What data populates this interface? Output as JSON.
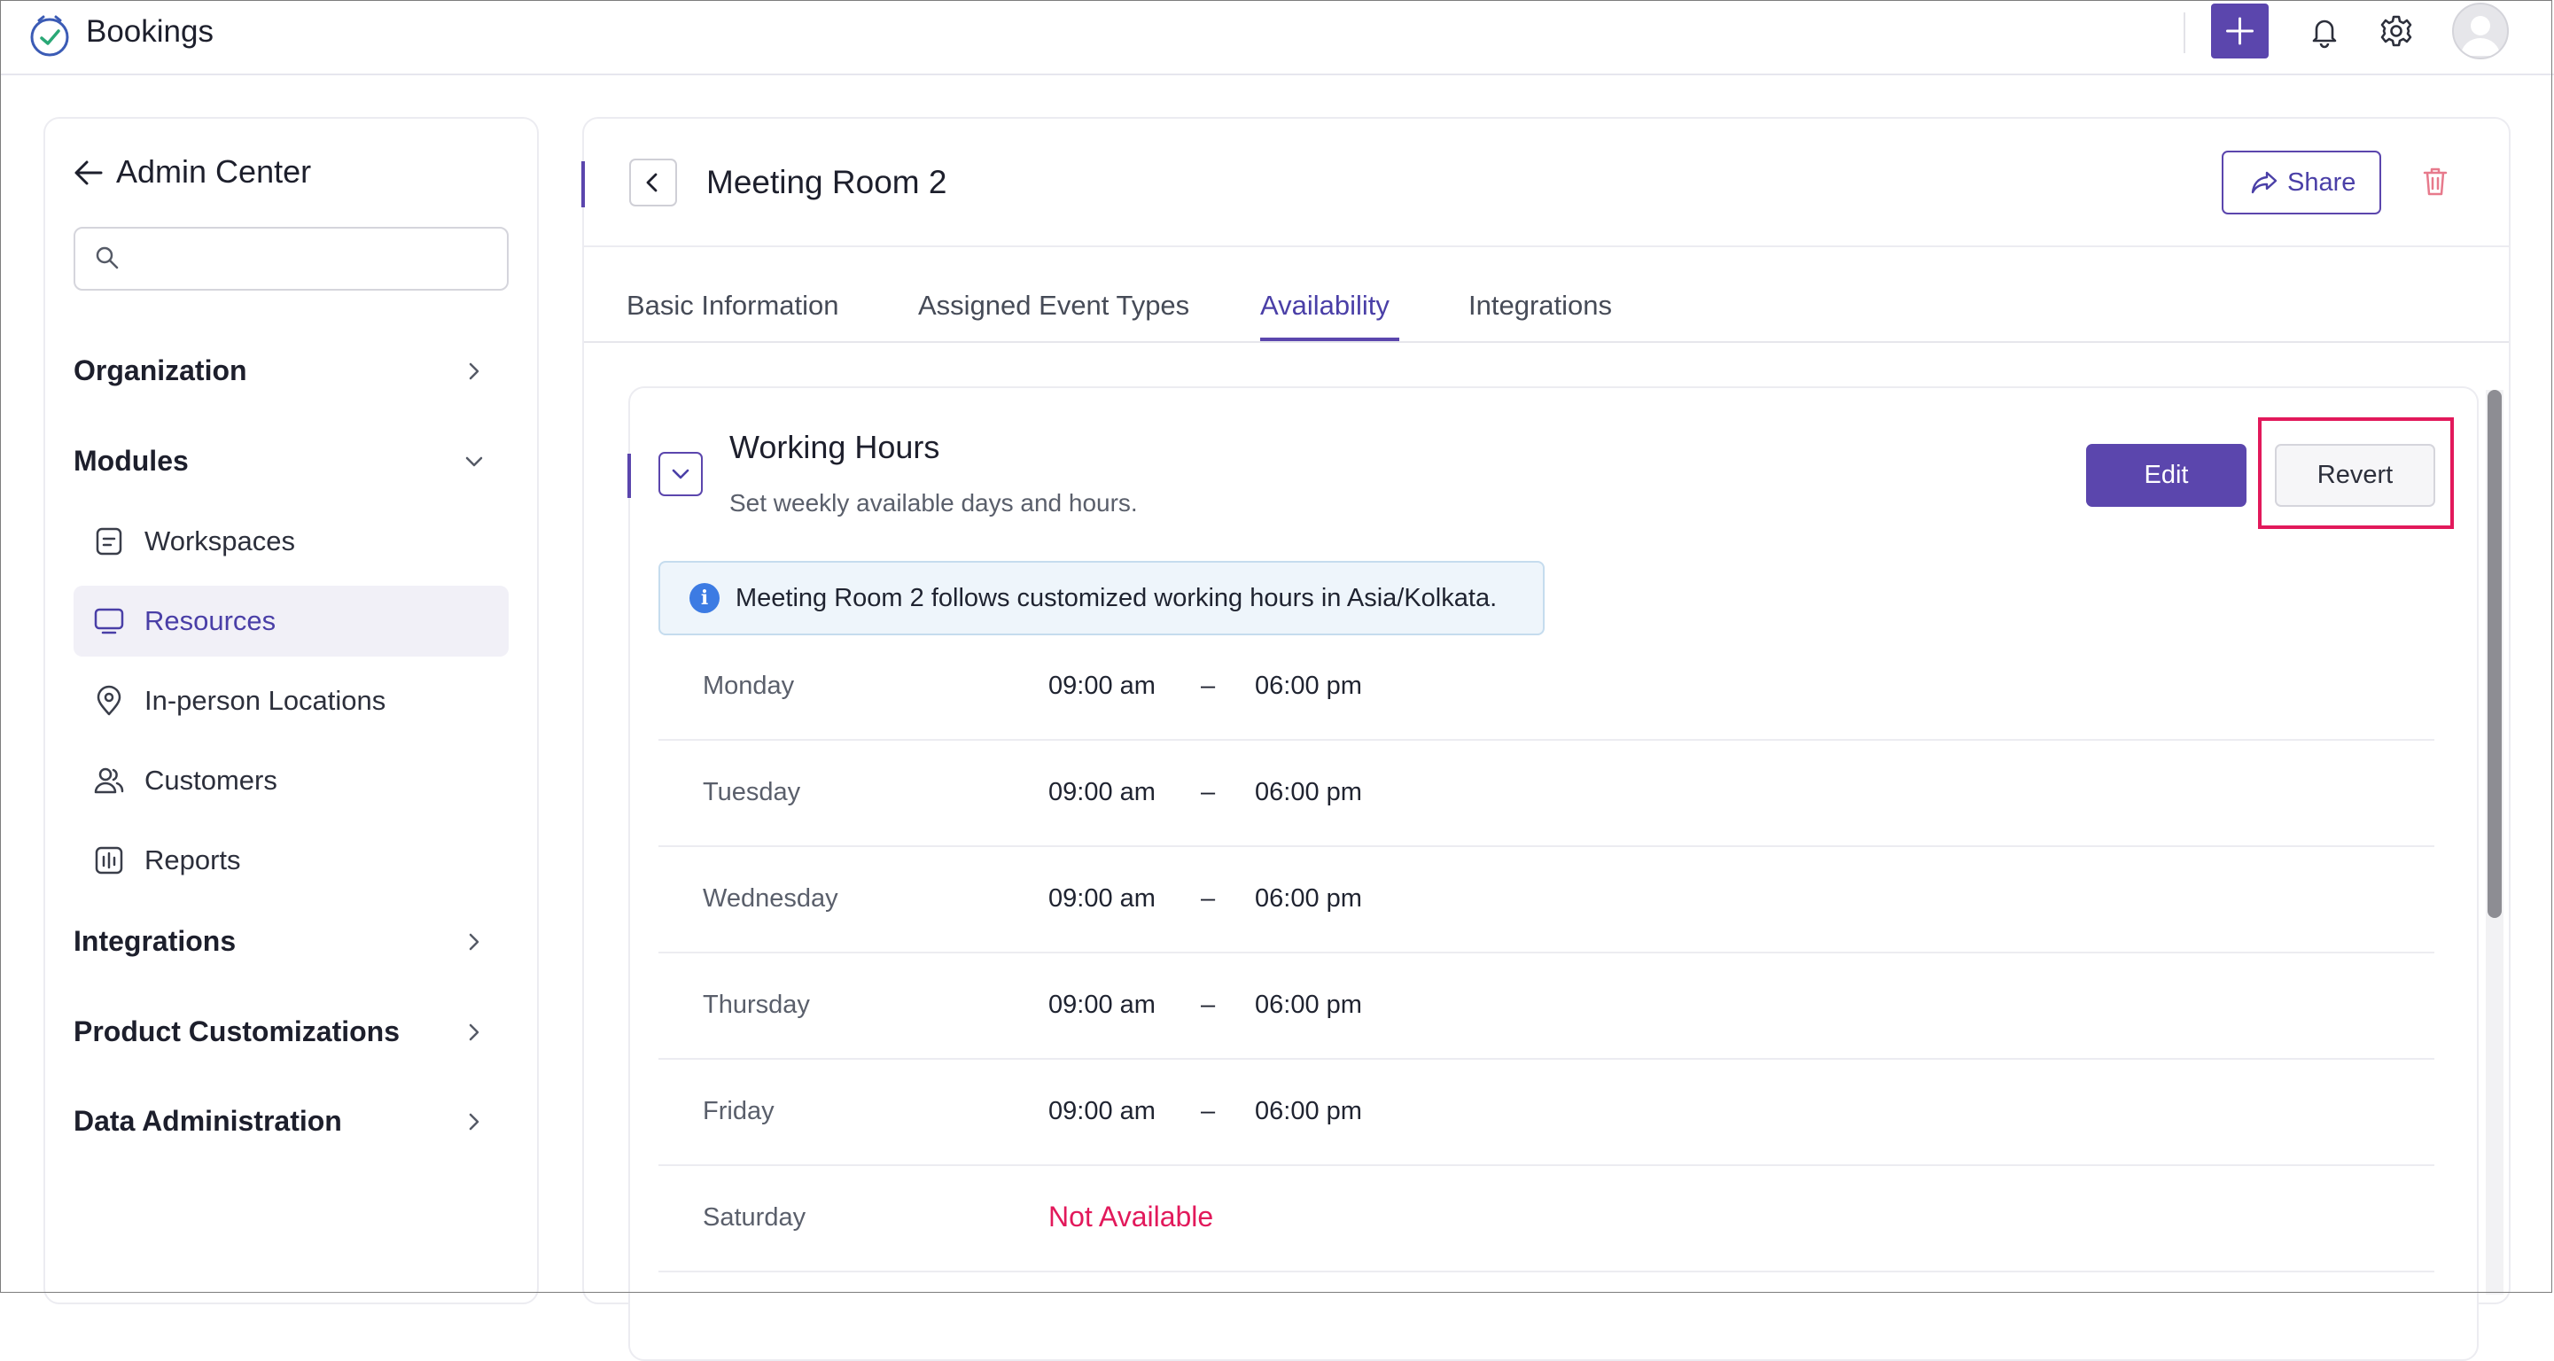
{
  "app": {
    "name": "Bookings",
    "icon": "calendar-check-icon"
  },
  "topbar": {
    "add_icon": "plus-icon",
    "notifications_icon": "bell-icon",
    "settings_icon": "gear-icon",
    "avatar_icon": "user-avatar-icon"
  },
  "sidebar": {
    "title": "Admin Center",
    "back_icon": "arrow-left-icon",
    "search": {
      "placeholder": "",
      "icon": "search-icon"
    },
    "sections": [
      {
        "label": "Organization",
        "state": "collapsed"
      },
      {
        "label": "Modules",
        "state": "expanded"
      },
      {
        "label": "Integrations",
        "state": "collapsed"
      },
      {
        "label": "Product Customizations",
        "state": "collapsed"
      },
      {
        "label": "Data Administration",
        "state": "collapsed"
      }
    ],
    "module_items": [
      {
        "label": "Workspaces",
        "icon": "workspace-icon"
      },
      {
        "label": "Resources",
        "icon": "monitor-icon",
        "active": true
      },
      {
        "label": "In-person Locations",
        "icon": "location-pin-icon"
      },
      {
        "label": "Customers",
        "icon": "users-icon"
      },
      {
        "label": "Reports",
        "icon": "reports-icon"
      }
    ]
  },
  "header": {
    "title": "Meeting Room 2",
    "share_label": "Share",
    "share_icon": "share-icon",
    "delete_icon": "trash-icon"
  },
  "tabs": [
    {
      "label": "Basic Information"
    },
    {
      "label": "Assigned Event Types"
    },
    {
      "label": "Availability",
      "active": true
    },
    {
      "label": "Integrations"
    }
  ],
  "working_hours": {
    "title": "Working Hours",
    "subtitle": "Set weekly available days and hours.",
    "edit_label": "Edit",
    "revert_label": "Revert",
    "info_text": "Meeting Room 2 follows customized working hours in Asia/Kolkata.",
    "separator": "–",
    "days": [
      {
        "day": "Monday",
        "start": "09:00 am",
        "end": "06:00 pm"
      },
      {
        "day": "Tuesday",
        "start": "09:00 am",
        "end": "06:00 pm"
      },
      {
        "day": "Wednesday",
        "start": "09:00 am",
        "end": "06:00 pm"
      },
      {
        "day": "Thursday",
        "start": "09:00 am",
        "end": "06:00 pm"
      },
      {
        "day": "Friday",
        "start": "09:00 am",
        "end": "06:00 pm"
      },
      {
        "day": "Saturday",
        "status": "Not Available"
      }
    ]
  },
  "colors": {
    "accent": "#5b46ad",
    "unavailable": "#e2195b",
    "highlight": "#e2195b",
    "info": "#3c7be3"
  }
}
